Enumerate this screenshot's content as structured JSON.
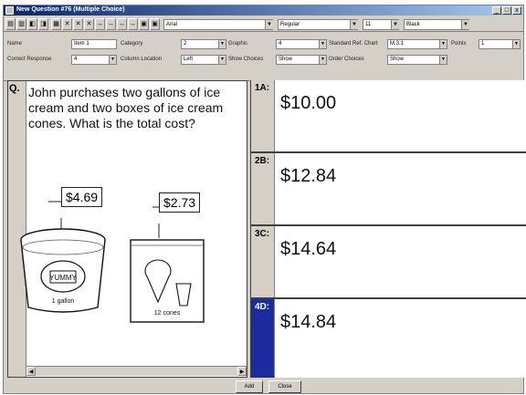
{
  "window": {
    "title": "New Question #76 (Multiple Choice)"
  },
  "title_buttons": [
    "_",
    "□",
    "x"
  ],
  "toolbar": {
    "buttons": [
      "1",
      "2",
      "3",
      "4",
      "5",
      "6",
      "7",
      "8",
      "9",
      "10",
      "11",
      "12",
      "13",
      "14"
    ],
    "font_dropdown": "Arial",
    "style_dropdown": "Regular",
    "size_dropdown": "11",
    "color_dropdown": "Black"
  },
  "properties": {
    "name_label": "Name",
    "name_value": "Item 1",
    "category_label": "Category",
    "category_value": "2",
    "graphic_label": "Graphic",
    "graphic_value": "4",
    "standard_label": "Standard Ref. Chart",
    "standard_value": "M.3.1",
    "points_label": "Points",
    "points_value": "1",
    "correct_label": "Correct Response",
    "correct_value": "4",
    "layout_label": "Column Location",
    "layout_value": "Left",
    "answer_choices_label": "Show Choices",
    "answer_choices_value": "Show",
    "order_choices_label": "Order Choices",
    "order_choices_value": "Show"
  },
  "question": {
    "label": "Q.",
    "text": "John purchases two gallons of ice cream and two boxes of ice cream cones. What is the total cost?",
    "price_1": "$4.69",
    "price_2": "$2.73",
    "item_1_caption": "1 gallon",
    "item_1_brand": "YUMMY",
    "item_2_caption": "12 cones"
  },
  "answers": [
    {
      "label": "1A:",
      "value": "$10.00"
    },
    {
      "label": "2B:",
      "value": "$12.84"
    },
    {
      "label": "3C:",
      "value": "$14.64"
    },
    {
      "label": "4D:",
      "value": "$14.84"
    }
  ],
  "bottom": {
    "add_label": "Add",
    "close_label": "Close"
  },
  "colors": {
    "selected": "#1a2c9e",
    "titlebar": "#0a246a"
  }
}
